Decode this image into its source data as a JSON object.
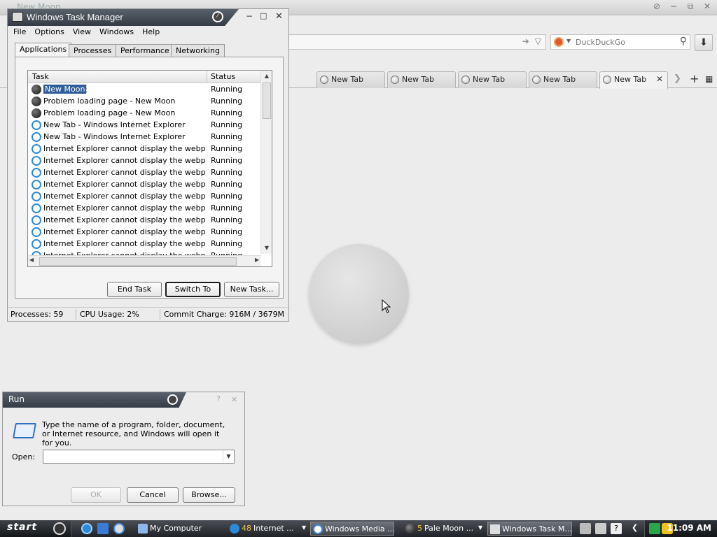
{
  "browser": {
    "title": "New Moon",
    "search": {
      "engine_icon": "duckduckgo-icon",
      "placeholder": "DuckDuckGo"
    },
    "tabs": [
      {
        "label": "New Tab"
      },
      {
        "label": "New Tab"
      },
      {
        "label": "New Tab"
      },
      {
        "label": "New Tab"
      },
      {
        "label": "New Tab"
      }
    ],
    "accent": "#2f5d9a"
  },
  "task_manager": {
    "title": "Windows Task Manager",
    "menu": [
      "File",
      "Options",
      "View",
      "Windows",
      "Help"
    ],
    "tabs": [
      "Applications",
      "Processes",
      "Performance",
      "Networking"
    ],
    "columns": {
      "task": "Task",
      "status": "Status"
    },
    "rows": [
      {
        "icon": "moon",
        "task": "New Moon",
        "status": "Running"
      },
      {
        "icon": "moon",
        "task": "Problem loading page - New Moon",
        "status": "Running"
      },
      {
        "icon": "moon",
        "task": "Problem loading page - New Moon",
        "status": "Running"
      },
      {
        "icon": "ie",
        "task": "New Tab - Windows Internet Explorer",
        "status": "Running"
      },
      {
        "icon": "ie",
        "task": "New Tab - Windows Internet Explorer",
        "status": "Running"
      },
      {
        "icon": "ie",
        "task": "Internet Explorer cannot display the webpag...",
        "status": "Running"
      },
      {
        "icon": "ie",
        "task": "Internet Explorer cannot display the webpag...",
        "status": "Running"
      },
      {
        "icon": "ie",
        "task": "Internet Explorer cannot display the webpag...",
        "status": "Running"
      },
      {
        "icon": "ie",
        "task": "Internet Explorer cannot display the webpag...",
        "status": "Running"
      },
      {
        "icon": "ie",
        "task": "Internet Explorer cannot display the webpag...",
        "status": "Running"
      },
      {
        "icon": "ie",
        "task": "Internet Explorer cannot display the webpag...",
        "status": "Running"
      },
      {
        "icon": "ie",
        "task": "Internet Explorer cannot display the webpag...",
        "status": "Running"
      },
      {
        "icon": "ie",
        "task": "Internet Explorer cannot display the webpag...",
        "status": "Running"
      },
      {
        "icon": "ie",
        "task": "Internet Explorer cannot display the webpag...",
        "status": "Running"
      },
      {
        "icon": "ie",
        "task": "Internet Explorer cannot display the webpag...",
        "status": "Running"
      }
    ],
    "buttons": {
      "end_task": "End Task",
      "switch_to": "Switch To",
      "new_task": "New Task..."
    },
    "status": {
      "processes": "Processes: 59",
      "cpu": "CPU Usage: 2%",
      "commit": "Commit Charge: 916M / 3679M"
    }
  },
  "run_dialog": {
    "title": "Run",
    "description": "Type the name of a program, folder, document, or Internet resource, and Windows will open it for you.",
    "open_label": "Open:",
    "open_value": "",
    "buttons": {
      "ok": "OK",
      "cancel": "Cancel",
      "browse": "Browse..."
    }
  },
  "taskbar": {
    "start_label": "start",
    "quick_launch": [
      "ie-icon",
      "ie-alt-icon",
      "media-player-icon"
    ],
    "items": [
      {
        "label": "My Computer",
        "icon": "computer-icon"
      },
      {
        "count": "48",
        "label": "Internet ...",
        "icon": "ie-icon"
      },
      {
        "label": "Windows Media ...",
        "icon": "media-player-icon"
      },
      {
        "count": "5",
        "label": "Pale Moon ...",
        "icon": "moon-icon"
      },
      {
        "label": "Windows Task M...",
        "icon": "task-manager-icon"
      }
    ],
    "clock": "11:09 AM"
  }
}
